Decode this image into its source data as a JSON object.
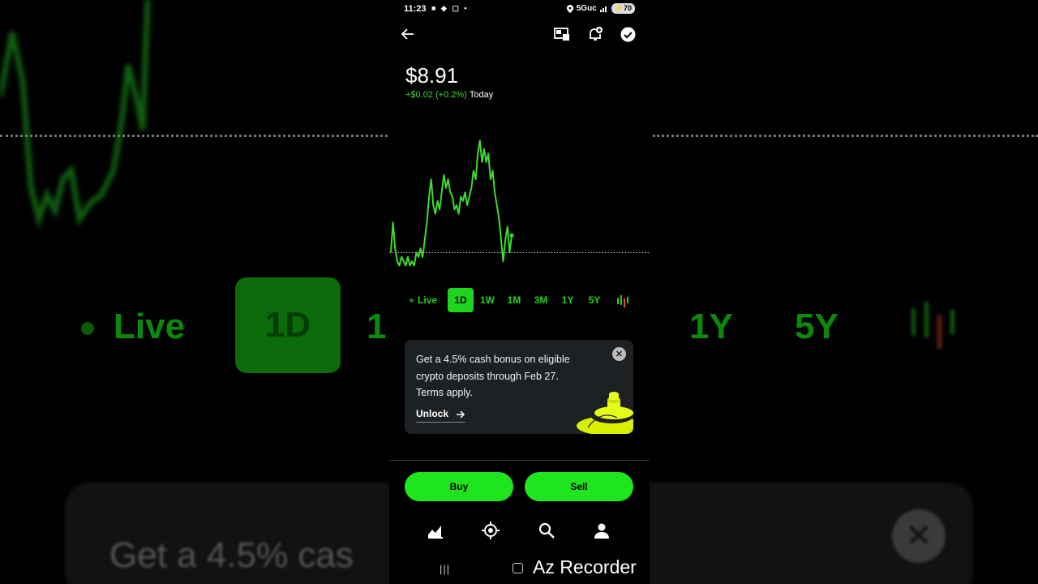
{
  "status_bar": {
    "time": "11:23",
    "network": "5Guc",
    "battery": "70"
  },
  "stock": {
    "price": "$8.91",
    "change": "+$0.02 (+0.2%)",
    "period_label": "Today"
  },
  "chart_data": {
    "type": "line",
    "color": "#3ddc2e",
    "baseline_color": "#cccccc",
    "x": [
      0,
      1,
      2,
      3,
      4,
      5,
      6,
      7,
      8,
      9,
      10,
      11,
      12,
      13,
      14,
      15,
      16,
      17,
      18,
      19,
      20,
      21,
      22,
      23,
      24,
      25,
      26,
      27,
      28,
      29,
      30,
      31,
      32,
      33,
      34,
      35,
      36,
      37,
      38,
      39,
      40,
      41,
      42,
      43,
      44,
      45,
      46,
      47,
      48,
      49,
      50,
      51,
      52,
      53,
      54,
      55,
      56,
      57,
      58,
      59,
      60,
      61,
      62,
      63,
      64,
      65,
      66,
      67,
      68,
      69,
      70,
      71,
      72,
      73,
      74,
      75,
      76,
      77,
      78,
      79
    ],
    "y": [
      8.89,
      8.96,
      8.9,
      8.87,
      8.86,
      8.88,
      8.87,
      8.86,
      8.88,
      8.86,
      8.87,
      8.86,
      8.89,
      8.88,
      8.9,
      8.88,
      8.92,
      8.96,
      9.02,
      9.06,
      9.0,
      8.98,
      9.01,
      8.99,
      9.03,
      9.07,
      9.04,
      9.06,
      9.03,
      9.02,
      8.99,
      9.0,
      8.98,
      9.02,
      9.01,
      9.03,
      9.0,
      9.02,
      9.04,
      9.08,
      9.06,
      9.12,
      9.15,
      9.1,
      9.13,
      9.1,
      9.12,
      9.06,
      9.08,
      9.03,
      9.0,
      8.97,
      8.92,
      8.87,
      8.92,
      8.95,
      8.89,
      8.93,
      8.9,
      8.88,
      8.9,
      8.89,
      8.9,
      8.91,
      8.9,
      8.91,
      8.9,
      8.91,
      8.9,
      8.91,
      8.9,
      8.91,
      8.9,
      8.91,
      8.9,
      8.91,
      8.9,
      8.91,
      8.9,
      8.91
    ],
    "points_drawn": 58,
    "baseline": 8.89
  },
  "ranges": [
    "Live",
    "1D",
    "1W",
    "1M",
    "3M",
    "1Y",
    "5Y"
  ],
  "active_range": "1D",
  "promo": {
    "text": "Get a 4.5% cash bonus on eligible crypto deposits through Feb 27. Terms apply.",
    "link": "Unlock"
  },
  "actions": {
    "buy": "Buy",
    "sell": "Sell"
  },
  "watermark": "Az Recorder",
  "backdrop": {
    "live": "Live",
    "one_d": "1D",
    "one_w": "1",
    "one_y": "1Y",
    "five_y": "5Y",
    "card_text": "Get a 4.5% cas"
  },
  "colors": {
    "accent": "#1fe51f",
    "line": "#3ddc2e",
    "card_bg": "#1e2124"
  },
  "icons": [
    "back-arrow-icon",
    "share-screen-icon",
    "bell-plus-icon",
    "check-circle-icon",
    "candlestick-icon",
    "close-icon",
    "arrow-right-icon",
    "chart-nav-icon",
    "crypto-nav-icon",
    "search-nav-icon",
    "account-nav-icon"
  ]
}
